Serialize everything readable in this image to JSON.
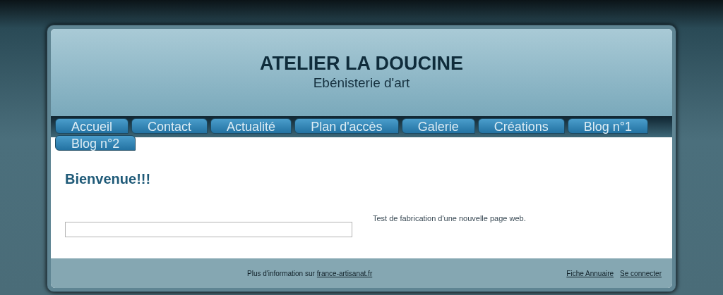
{
  "header": {
    "title": "ATELIER LA DOUCINE",
    "subtitle": "Ebénisterie d'art"
  },
  "nav": [
    "Accueil",
    "Contact",
    "Actualité",
    "Plan d'accès",
    "Galerie",
    "Créations",
    "Blog n°1",
    "Blog n°2"
  ],
  "content": {
    "heading": "Bienvenue!!!",
    "text": "Test de fabrication d'une nouvelle page web."
  },
  "footer": {
    "info": "Plus d'information sur",
    "info_link": "france-artisanat.fr",
    "links": [
      "Fiche Annuaire",
      "Se connecter"
    ]
  }
}
